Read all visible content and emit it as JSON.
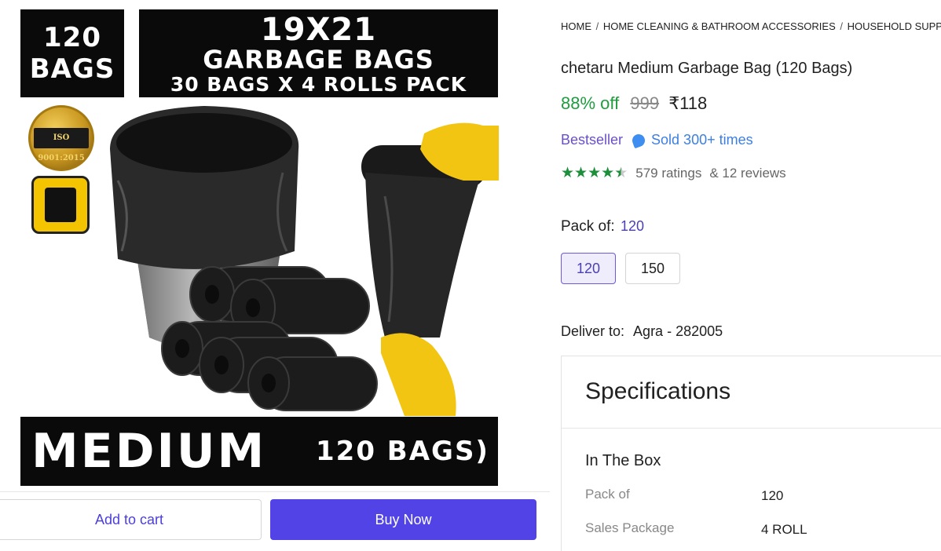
{
  "image": {
    "count_label": [
      "120",
      "BAGS"
    ],
    "headline_line1": "19X21",
    "headline_line2": "GARBAGE BAGS",
    "headline_line3": "30 BAGS X 4 ROLLS PACK",
    "iso_text": "ISO 9001:2015",
    "bottom_big": "MEDIUM",
    "bottom_small": "120 BAGS)"
  },
  "actions": {
    "add_to_cart": "Add to cart",
    "buy_now": "Buy Now"
  },
  "breadcrumb": [
    "HOME",
    "HOME CLEANING & BATHROOM ACCESSORIES",
    "HOUSEHOLD SUPPLIES"
  ],
  "product": {
    "title": "chetaru Medium Garbage Bag (120 Bags)",
    "discount": "88% off",
    "mrp": "999",
    "price": "₹118",
    "bestseller": "Bestseller",
    "sold": "Sold 300+ times",
    "rating_value": 4.5,
    "ratings": "579 ratings",
    "reviews": "& 12 reviews"
  },
  "pack": {
    "label": "Pack of:",
    "selected": "120",
    "options": [
      "120",
      "150"
    ]
  },
  "delivery": {
    "label": "Deliver to:",
    "location": "Agra - 282005"
  },
  "specifications": {
    "title": "Specifications",
    "group": "In The Box",
    "rows": [
      {
        "key": "Pack of",
        "value": "120"
      },
      {
        "key": "Sales Package",
        "value": "4 ROLL"
      }
    ]
  },
  "colors": {
    "accent": "#5143e6",
    "discount": "#1f9d3f",
    "rating": "#1d8f3a",
    "bestseller": "#6b4fc7"
  }
}
